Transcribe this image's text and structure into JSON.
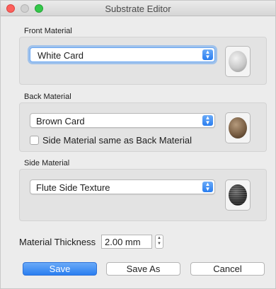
{
  "window": {
    "title": "Substrate Editor"
  },
  "front": {
    "label": "Front Material",
    "selected": "White Card",
    "swatch_icon": "white-material-sphere",
    "swatch_color": "#c9c9c9"
  },
  "back": {
    "label": "Back Material",
    "selected": "Brown Card",
    "checkbox_label": "Side Material same as Back Material",
    "checkbox_checked": false,
    "swatch_icon": "brown-material-sphere",
    "swatch_color": "#7a5f44"
  },
  "side": {
    "label": "Side Material",
    "selected": "Flute Side Texture",
    "swatch_icon": "flute-texture-sphere",
    "swatch_color": "#2d2d2d"
  },
  "thickness": {
    "label": "Material Thickness",
    "value": "2.00 mm"
  },
  "buttons": {
    "save": "Save",
    "save_as": "Save As",
    "cancel": "Cancel"
  },
  "colors": {
    "accent": "#2a7ef0",
    "close": "#fc605c",
    "maximize": "#34c84a"
  }
}
